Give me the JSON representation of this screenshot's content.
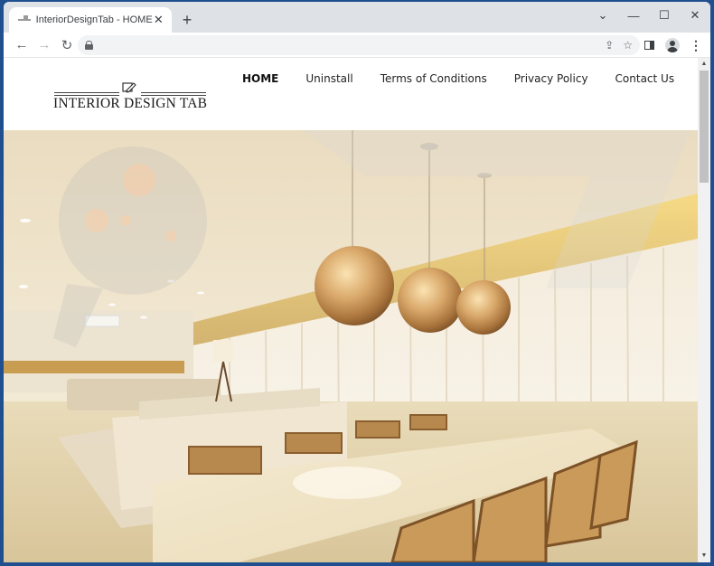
{
  "browser": {
    "tab": {
      "title": "InteriorDesignTab - HOME",
      "favicon": "interior-design-tab-favicon",
      "close_glyph": "✕"
    },
    "new_tab_glyph": "+",
    "window_controls": {
      "tab_search_glyph": "⌄",
      "minimize_glyph": "—",
      "maximize_glyph": "☐",
      "close_glyph": "✕"
    },
    "toolbar": {
      "back_glyph": "←",
      "forward_glyph": "→",
      "reload_glyph": "↻",
      "address_value": "",
      "share_glyph": "⇪",
      "bookmark_glyph": "☆",
      "menu_glyph": "⋮"
    }
  },
  "site": {
    "logo_text": "INTERIOR DESIGN TAB",
    "nav": [
      {
        "label": "HOME",
        "active": true
      },
      {
        "label": "Uninstall",
        "active": false
      },
      {
        "label": "Terms of Conditions",
        "active": false
      },
      {
        "label": "Privacy Policy",
        "active": false
      },
      {
        "label": "Contact Us",
        "active": false
      }
    ],
    "hero": {
      "description": "Interior photo of a bright living and dining room with three gold pendant globe lights, sheer curtains, cream sofas and a dining table with cane chairs",
      "watermark": "pc-risk-watermark"
    }
  },
  "scrollbar": {
    "up_glyph": "▲",
    "down_glyph": "▼"
  },
  "colors": {
    "window_frame": "#1f4f8f",
    "tabstrip": "#dee1e6",
    "omnibox": "#f1f3f4",
    "nav_text": "#222222"
  }
}
